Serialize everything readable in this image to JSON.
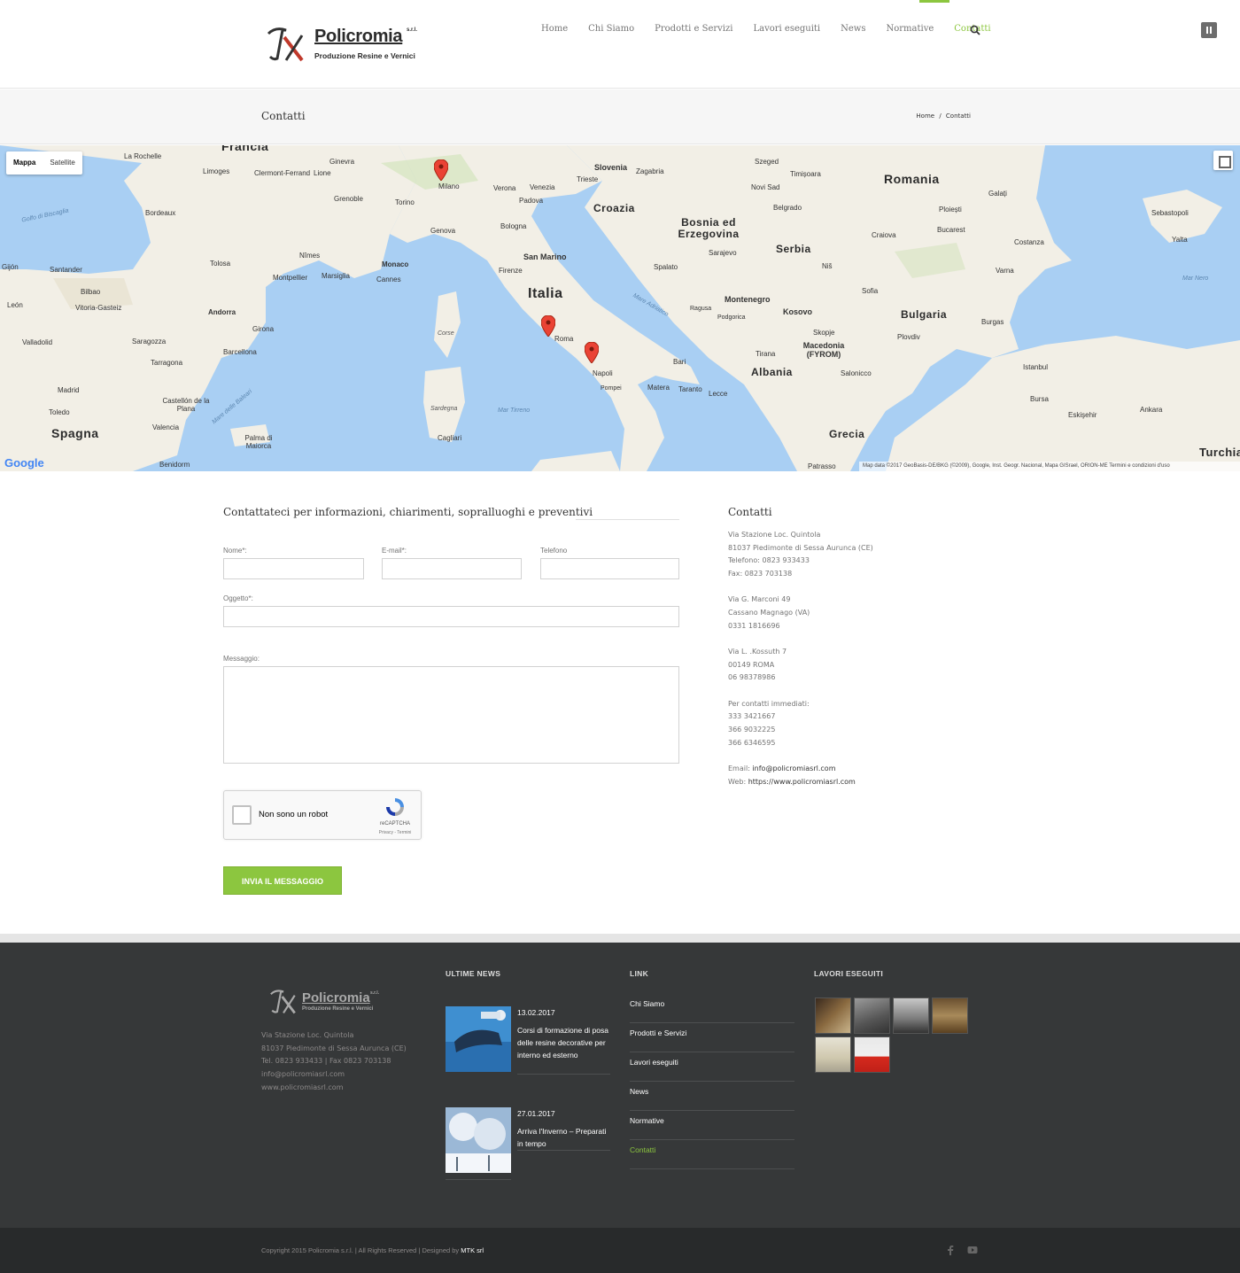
{
  "header": {
    "logo_name": "Policromia",
    "logo_srl": "s.r.l.",
    "logo_sub": "Produzione Resine e Vernici",
    "nav": [
      "Home",
      "Chi Siamo",
      "Prodotti e Servizi",
      "Lavori eseguiti",
      "News",
      "Normative",
      "Contatti"
    ],
    "active_nav": "Contatti"
  },
  "titlebar": {
    "title": "Contatti",
    "breadcrumb_home": "Home",
    "breadcrumb_sep": "/",
    "breadcrumb_current": "Contatti"
  },
  "map": {
    "type_map": "Mappa",
    "type_satellite": "Satellite",
    "zoom_in": "+",
    "zoom_out": "−",
    "google": "Google",
    "attribution": "Map data ©2017 GeoBasis-DE/BKG (©2009), Google, Inst. Geogr. Nacional, Mapa GISrael, ORION-ME     Termini e condizioni d'uso",
    "countries": [
      "Francia",
      "Romania",
      "Slovenia",
      "Croazia",
      "Bosnia ed Erzegovina",
      "Serbia",
      "Italia",
      "Montenegro",
      "Kosovo",
      "Bulgaria",
      "Macedonia (FYROM)",
      "Albania",
      "Grecia",
      "Spagna",
      "Andorra",
      "Monaco",
      "Turchia"
    ],
    "cities": [
      "La Rochelle",
      "Limoges",
      "Clermont-Ferrand",
      "Lione",
      "Ginevra",
      "Milano",
      "Verona",
      "Venezia",
      "Trieste",
      "Zagabria",
      "Szeged",
      "Timișoara",
      "Novi Sad",
      "Belgrado",
      "Bordeaux",
      "Grenoble",
      "Torino",
      "Genova",
      "Bologna",
      "Padova",
      "Spalato",
      "Sarajevo",
      "Ploiești",
      "Bucarest",
      "Craiova",
      "Costanza",
      "Sebastopoli",
      "Yalta",
      "Galați",
      "Tolosa",
      "Nîmes",
      "Montpellier",
      "Marsiglia",
      "Cannes",
      "Firenze",
      "San Marino",
      "Niš",
      "Sofia",
      "Varna",
      "Burgas",
      "Santander",
      "Bilbao",
      "Vitoria-Gasteiz",
      "Gijón",
      "León",
      "Valladolid",
      "Saragozza",
      "Barcellona",
      "Girona",
      "Tarragona",
      "Roma",
      "Napoli",
      "Bari",
      "Pompei",
      "Matera",
      "Taranto",
      "Lecce",
      "Podgorica",
      "Ragusa",
      "Tirana",
      "Skopje",
      "Plovdiv",
      "Istanbul",
      "Bursa",
      "Salonicco",
      "Madrid",
      "Toledo",
      "Valencia",
      "Castellón de la Plana",
      "Palma di Maiorca",
      "Cagliari",
      "Sardegna",
      "Corse",
      "Benidorm",
      "Eskişehir",
      "Ankara",
      "Patrasso"
    ],
    "seas": [
      "Golfo di Biscaglia",
      "Mare Adriatico",
      "Mar Tirreno",
      "Mare delle Baleari",
      "Mar Nero"
    ]
  },
  "form": {
    "title": "Contattateci per informazioni, chiarimenti, sopralluoghi e preventivi",
    "name_label": "Nome*:",
    "email_label": "E-mail*:",
    "phone_label": "Telefono",
    "subject_label": "Oggetto*:",
    "message_label": "Messaggio:",
    "name_value": "",
    "email_value": "",
    "phone_value": "",
    "subject_value": "",
    "message_value": "",
    "captcha_label": "Non sono un robot",
    "captcha_brand": "reCAPTCHA",
    "captcha_terms": "Privacy - Termini",
    "submit": "INVIA IL MESSAGGIO"
  },
  "contacts": {
    "title": "Contatti",
    "block1": [
      "Via Stazione Loc. Quintola",
      "81037 Piedimonte di Sessa Aurunca (CE)",
      "Telefono: 0823 933433",
      "Fax: 0823 703138"
    ],
    "block2": [
      "Via G. Marconi 49",
      "Cassano Magnago (VA)",
      "0331 1816696"
    ],
    "block3": [
      "Via L. .Kossuth 7",
      "00149 ROMA",
      "06 98378986"
    ],
    "block4": [
      "Per contatti immediati:",
      "333 3421667",
      "366 9032225",
      "366 6346595"
    ],
    "email_label": "Email: ",
    "email": "info@policromiasrl.com",
    "web_label": "Web: ",
    "web": "https://www.policromiasrl.com"
  },
  "footer": {
    "logo_name": "Policromia",
    "logo_srl": "s.r.l.",
    "logo_sub": "Produzione Resine e Vernici",
    "address": [
      "Via Stazione Loc. Quintola",
      "81037 Piedimonte di Sessa Aurunca (CE)",
      "Tel. 0823 933433 | Fax 0823 703138",
      "info@policromiasrl.com",
      "www.policromiasrl.com"
    ],
    "news_heading": "ULTIME NEWS",
    "news": [
      {
        "date": "13.02.2017",
        "title": "Corsi di formazione di posa delle resine decorative per interno ed esterno"
      },
      {
        "date": "27.01.2017",
        "title": "Arriva l'Inverno – Preparati in tempo"
      }
    ],
    "link_heading": "LINK",
    "links": [
      "Chi Siamo",
      "Prodotti e Servizi",
      "Lavori eseguiti",
      "News",
      "Normative",
      "Contatti"
    ],
    "active_link": "Contatti",
    "works_heading": "LAVORI ESEGUITI",
    "copyright": "Copyright 2015 Policromia s.r.l. | All Rights Reserved | Designed by ",
    "designer": "MTK srl"
  },
  "colors": {
    "accent": "#8cc63f",
    "footer_bg": "#363839",
    "bottombar_bg": "#282a2b",
    "map_sea": "#a9cff3",
    "map_land": "#f2efe6"
  },
  "icons": [
    "search-icon",
    "menu-icon",
    "facebook-icon",
    "youtube-icon",
    "fullscreen-icon",
    "pegman-icon",
    "map-pin-icon",
    "recaptcha-icon"
  ]
}
